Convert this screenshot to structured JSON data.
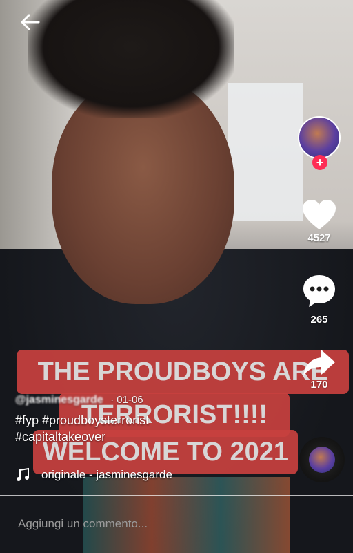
{
  "overlay": {
    "line1": "THE PROUDBOYS ARE",
    "line2": "TERRORIST!!!!",
    "line3": "WELCOME TO 2021"
  },
  "sidebar": {
    "likes": "4527",
    "comments": "265",
    "shares": "170",
    "follow_symbol": "+"
  },
  "caption": {
    "username": "@jasminesgarde",
    "date": "· 01-06",
    "hashtags_line1": "#fyp #proudboysterrorist",
    "hashtags_line2": "#capitaltakeover",
    "music": "originale - jasminesgarde"
  },
  "comment_placeholder": "Aggiungi un commento...",
  "icons": [
    "back-arrow-icon",
    "heart-icon",
    "comment-bubble-icon",
    "share-arrow-icon",
    "music-note-icon"
  ],
  "colors": {
    "follow": "#fe2c55",
    "overlay": "#c8413f"
  }
}
